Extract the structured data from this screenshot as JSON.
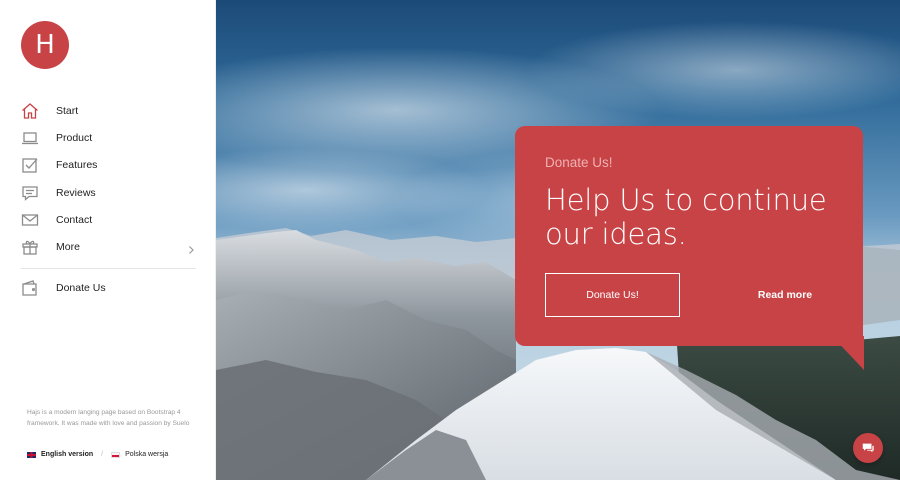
{
  "logo": {
    "letter": "H"
  },
  "nav": {
    "items": [
      {
        "label": "Start",
        "icon": "home-icon",
        "active": true
      },
      {
        "label": "Product",
        "icon": "laptop-icon"
      },
      {
        "label": "Features",
        "icon": "checkbox-icon"
      },
      {
        "label": "Reviews",
        "icon": "chat-bubble-icon"
      },
      {
        "label": "Contact",
        "icon": "envelope-icon"
      },
      {
        "label": "More",
        "icon": "gift-icon",
        "submenu": true
      },
      {
        "label": "Donate Us",
        "icon": "wallet-icon"
      }
    ]
  },
  "footer": {
    "about": "Hajs is a modern langing page based on Bootstrap 4 framework. It was made with love and passion by Suelo",
    "lang_en": "English version",
    "lang_pl": "Polska wersja",
    "separator": "/"
  },
  "hero": {
    "kicker": "Donate Us!",
    "headline": "Help Us to continue our ideas.",
    "donate_button": "Donate Us!",
    "readmore_button": "Read more"
  },
  "colors": {
    "accent": "#c84346"
  }
}
